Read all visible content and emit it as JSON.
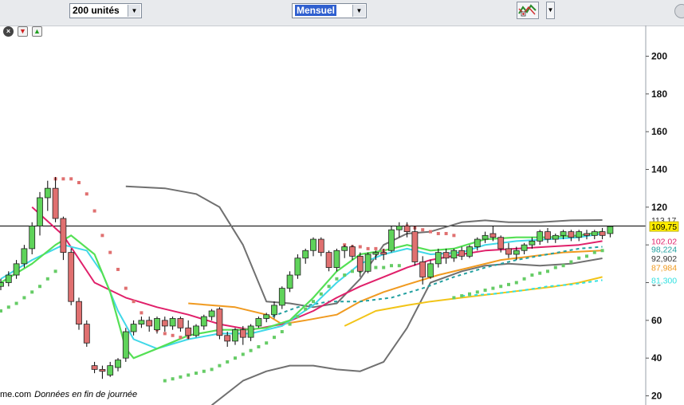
{
  "toolbar": {
    "period_select": "200 unités",
    "interval_select": "Mensuel"
  },
  "footer": {
    "source_fragment": "me.com",
    "note": "Données en fin de journée"
  },
  "colors": {
    "bull": "#5fd35a",
    "bear": "#e07070",
    "bollinger": "#707070",
    "ma_red": "#e0206a",
    "ma_green": "#55e055",
    "ma_cyan": "#40d8e8",
    "ma_orange": "#f09a20",
    "ma_yellow": "#f2c418",
    "dashed_teal": "#22a0a0",
    "dashed_cyan": "#30e0e0",
    "psar_bear": "#e07070",
    "psar_bull": "#66cc66"
  },
  "chart_data": {
    "type": "candlestick",
    "ylim": [
      15,
      220
    ],
    "yticks": [
      20,
      40,
      60,
      80,
      100,
      120,
      140,
      160,
      180,
      200
    ],
    "reference_line": 110,
    "price_labels": [
      {
        "text": "113,17",
        "value": 113.17,
        "bg": "#ffffff",
        "color": "#333333"
      },
      {
        "text": "109,75",
        "value": 109.75,
        "bg": "#ffee00",
        "color": "#000000"
      },
      {
        "text": "102,02",
        "value": 102.02,
        "bg": "#ffffff",
        "color": "#e0206a"
      },
      {
        "text": "98,224",
        "value": 97.8,
        "bg": "#ffffff",
        "color": "#22a0a0"
      },
      {
        "text": "92,902",
        "value": 92.902,
        "bg": "#ffffff",
        "color": "#333333"
      },
      {
        "text": "87,984",
        "value": 87.984,
        "bg": "#ffffff",
        "color": "#f09a20"
      },
      {
        "text": "81,300",
        "value": 81.3,
        "bg": "#ffffff",
        "color": "#30e0e0"
      }
    ],
    "candles": [
      [
        78,
        82,
        76,
        80
      ],
      [
        80,
        86,
        78,
        84
      ],
      [
        84,
        92,
        82,
        90
      ],
      [
        90,
        100,
        88,
        98
      ],
      [
        98,
        112,
        95,
        110
      ],
      [
        110,
        128,
        105,
        125
      ],
      [
        125,
        134,
        118,
        130
      ],
      [
        130,
        136,
        112,
        114
      ],
      [
        114,
        115,
        92,
        96
      ],
      [
        96,
        98,
        68,
        70
      ],
      [
        70,
        72,
        55,
        58
      ],
      [
        58,
        60,
        46,
        48
      ],
      [
        36,
        38,
        32,
        34
      ],
      [
        34,
        36,
        29,
        33
      ],
      [
        31,
        38,
        30,
        36
      ],
      [
        35,
        40,
        33,
        39
      ],
      [
        40,
        56,
        38,
        54
      ],
      [
        54,
        60,
        52,
        58
      ],
      [
        58,
        62,
        56,
        60
      ],
      [
        60,
        62,
        54,
        57
      ],
      [
        55,
        62,
        53,
        61
      ],
      [
        60,
        62,
        54,
        57
      ],
      [
        57,
        62,
        55,
        61
      ],
      [
        61,
        62,
        54,
        56
      ],
      [
        56,
        60,
        50,
        52
      ],
      [
        52,
        58,
        51,
        57
      ],
      [
        57,
        63,
        55,
        62
      ],
      [
        62,
        66,
        60,
        65
      ],
      [
        66,
        67,
        50,
        52
      ],
      [
        52,
        54,
        46,
        49
      ],
      [
        49,
        56,
        47,
        55
      ],
      [
        55,
        57,
        47,
        51
      ],
      [
        51,
        58,
        49,
        57
      ],
      [
        57,
        62,
        56,
        61
      ],
      [
        61,
        64,
        59,
        63
      ],
      [
        63,
        70,
        61,
        68
      ],
      [
        68,
        78,
        66,
        77
      ],
      [
        77,
        86,
        75,
        84
      ],
      [
        84,
        95,
        82,
        93
      ],
      [
        93,
        98,
        90,
        97
      ],
      [
        97,
        104,
        94,
        103
      ],
      [
        103,
        104,
        94,
        96
      ],
      [
        96,
        97,
        86,
        88
      ],
      [
        88,
        98,
        86,
        97
      ],
      [
        97,
        100,
        93,
        99
      ],
      [
        99,
        100,
        92,
        94
      ],
      [
        94,
        96,
        83,
        86
      ],
      [
        86,
        96,
        85,
        95
      ],
      [
        95,
        97,
        92,
        96
      ],
      [
        96,
        98,
        92,
        95
      ],
      [
        97,
        110,
        96,
        108
      ],
      [
        108,
        112,
        104,
        110
      ],
      [
        110,
        112,
        104,
        107
      ],
      [
        107,
        110,
        89,
        91
      ],
      [
        91,
        94,
        79,
        83
      ],
      [
        83,
        92,
        82,
        90
      ],
      [
        90,
        98,
        88,
        96
      ],
      [
        96,
        98,
        90,
        93
      ],
      [
        93,
        98,
        91,
        97
      ],
      [
        97,
        99,
        92,
        94
      ],
      [
        94,
        100,
        93,
        99
      ],
      [
        99,
        104,
        97,
        103
      ],
      [
        103,
        107,
        101,
        105
      ],
      [
        106,
        110,
        102,
        104
      ],
      [
        104,
        105,
        96,
        98
      ],
      [
        98,
        101,
        93,
        95
      ],
      [
        95,
        99,
        92,
        97
      ],
      [
        97,
        101,
        95,
        100
      ],
      [
        100,
        104,
        98,
        102
      ],
      [
        102,
        108,
        100,
        107
      ],
      [
        107,
        109,
        101,
        103
      ],
      [
        103,
        106,
        101,
        105
      ],
      [
        105,
        108,
        103,
        107
      ],
      [
        107,
        108,
        102,
        104
      ],
      [
        104,
        108,
        102,
        107
      ],
      [
        106,
        108,
        103,
        105
      ],
      [
        105,
        108,
        103,
        107
      ],
      [
        107,
        109,
        103,
        105
      ],
      [
        106,
        110,
        104,
        109.75
      ]
    ],
    "bollinger_upper": [
      [
        16,
        131
      ],
      [
        21,
        130
      ],
      [
        25,
        127
      ],
      [
        28,
        120
      ],
      [
        31,
        100
      ],
      [
        34,
        70
      ],
      [
        37,
        69
      ],
      [
        40,
        67
      ],
      [
        43,
        69
      ],
      [
        46,
        82
      ],
      [
        49,
        100
      ],
      [
        52,
        106
      ],
      [
        55,
        107
      ],
      [
        59,
        112
      ],
      [
        62,
        113
      ],
      [
        65,
        112
      ],
      [
        69,
        112
      ],
      [
        73,
        113
      ],
      [
        77,
        113.17
      ]
    ],
    "bollinger_lower": [
      [
        27,
        15
      ],
      [
        31,
        28
      ],
      [
        34,
        33
      ],
      [
        37,
        36
      ],
      [
        40,
        36
      ],
      [
        43,
        34
      ],
      [
        46,
        33
      ],
      [
        49,
        38
      ],
      [
        52,
        56
      ],
      [
        55,
        80
      ],
      [
        59,
        86
      ],
      [
        62,
        89
      ],
      [
        65,
        90
      ],
      [
        69,
        89
      ],
      [
        73,
        90
      ],
      [
        77,
        92.902
      ]
    ],
    "ma_red": [
      [
        4,
        120
      ],
      [
        8,
        105
      ],
      [
        12,
        80
      ],
      [
        16,
        72
      ],
      [
        20,
        67
      ],
      [
        24,
        63
      ],
      [
        28,
        58
      ],
      [
        32,
        55
      ],
      [
        36,
        58
      ],
      [
        40,
        65
      ],
      [
        43,
        72
      ],
      [
        46,
        78
      ],
      [
        49,
        83
      ],
      [
        52,
        88
      ],
      [
        55,
        92
      ],
      [
        59,
        95
      ],
      [
        62,
        97
      ],
      [
        66,
        98
      ],
      [
        70,
        99
      ],
      [
        74,
        100
      ],
      [
        77,
        102
      ]
    ],
    "ma_green": [
      [
        0,
        80
      ],
      [
        4,
        90
      ],
      [
        7,
        100
      ],
      [
        9,
        105
      ],
      [
        12,
        95
      ],
      [
        14,
        75
      ],
      [
        16,
        45
      ],
      [
        17,
        40
      ],
      [
        20,
        45
      ],
      [
        24,
        52
      ],
      [
        28,
        55
      ],
      [
        31,
        55
      ],
      [
        34,
        56
      ],
      [
        37,
        60
      ],
      [
        40,
        72
      ],
      [
        43,
        86
      ],
      [
        46,
        95
      ],
      [
        49,
        97
      ],
      [
        52,
        100
      ],
      [
        55,
        97
      ],
      [
        58,
        98
      ],
      [
        62,
        103
      ],
      [
        66,
        104
      ],
      [
        70,
        104
      ],
      [
        74,
        105
      ],
      [
        77,
        107
      ]
    ],
    "ma_cyan": [
      [
        0,
        82
      ],
      [
        4,
        92
      ],
      [
        8,
        100
      ],
      [
        11,
        97
      ],
      [
        13,
        85
      ],
      [
        15,
        65
      ],
      [
        17,
        50
      ],
      [
        20,
        45
      ],
      [
        24,
        50
      ],
      [
        28,
        53
      ],
      [
        32,
        53
      ],
      [
        36,
        57
      ],
      [
        40,
        68
      ],
      [
        43,
        80
      ],
      [
        46,
        90
      ],
      [
        49,
        95
      ],
      [
        52,
        98
      ],
      [
        55,
        95
      ],
      [
        59,
        96
      ],
      [
        62,
        100
      ],
      [
        66,
        102
      ],
      [
        70,
        103
      ],
      [
        74,
        104
      ],
      [
        77,
        106
      ]
    ],
    "ma_orange": [
      [
        24,
        69
      ],
      [
        30,
        67
      ],
      [
        34,
        63
      ],
      [
        36,
        58
      ],
      [
        39,
        60
      ],
      [
        43,
        63
      ],
      [
        46,
        70
      ],
      [
        49,
        75
      ],
      [
        52,
        79
      ],
      [
        56,
        84
      ],
      [
        60,
        88
      ],
      [
        64,
        92
      ],
      [
        68,
        94
      ],
      [
        72,
        96
      ],
      [
        77,
        97
      ]
    ],
    "ma_yellow": [
      [
        44,
        57
      ],
      [
        48,
        65
      ],
      [
        52,
        68
      ],
      [
        55,
        70
      ],
      [
        59,
        72
      ],
      [
        63,
        74
      ],
      [
        67,
        76
      ],
      [
        71,
        78
      ],
      [
        74,
        80
      ],
      [
        77,
        83
      ]
    ],
    "dashed_teal": [
      [
        34,
        61
      ],
      [
        38,
        67
      ],
      [
        42,
        70
      ],
      [
        46,
        70
      ],
      [
        50,
        72
      ],
      [
        54,
        77
      ],
      [
        58,
        83
      ],
      [
        62,
        88
      ],
      [
        66,
        92
      ],
      [
        70,
        95
      ],
      [
        74,
        98
      ],
      [
        77,
        99
      ]
    ],
    "dashed_cyan": [
      [
        59,
        73
      ],
      [
        63,
        74
      ],
      [
        67,
        76
      ],
      [
        70,
        78
      ],
      [
        73,
        79
      ],
      [
        77,
        81.3
      ]
    ],
    "psar_bear_points": [
      [
        7,
        135
      ],
      [
        8,
        135
      ],
      [
        9,
        135
      ],
      [
        10,
        133
      ],
      [
        11,
        127
      ],
      [
        12,
        118
      ],
      [
        13,
        105
      ],
      [
        14,
        96
      ],
      [
        15,
        87
      ],
      [
        16,
        77
      ],
      [
        17,
        70
      ],
      [
        18,
        64
      ],
      [
        19,
        58
      ],
      [
        20,
        55
      ],
      [
        21,
        53
      ],
      [
        22,
        52
      ],
      [
        23,
        51
      ],
      [
        24,
        51
      ],
      [
        44,
        100
      ],
      [
        45,
        99
      ],
      [
        46,
        99
      ],
      [
        47,
        98
      ],
      [
        48,
        98
      ],
      [
        49,
        97
      ],
      [
        52,
        110
      ],
      [
        53,
        109
      ],
      [
        54,
        108
      ],
      [
        55,
        107
      ],
      [
        56,
        106
      ],
      [
        57,
        106
      ],
      [
        58,
        105
      ]
    ],
    "psar_bull_points": [
      [
        0,
        65
      ],
      [
        1,
        67
      ],
      [
        2,
        69
      ],
      [
        3,
        72
      ],
      [
        4,
        75
      ],
      [
        5,
        78
      ],
      [
        6,
        82
      ],
      [
        7,
        86
      ],
      [
        21,
        28
      ],
      [
        22,
        29
      ],
      [
        23,
        30
      ],
      [
        24,
        31
      ],
      [
        25,
        32
      ],
      [
        26,
        33
      ],
      [
        27,
        34
      ],
      [
        28,
        36
      ],
      [
        29,
        38
      ],
      [
        30,
        40
      ],
      [
        31,
        42
      ],
      [
        32,
        44
      ],
      [
        33,
        46
      ],
      [
        34,
        48
      ],
      [
        35,
        51
      ],
      [
        36,
        54
      ],
      [
        37,
        58
      ],
      [
        38,
        62
      ],
      [
        39,
        66
      ],
      [
        40,
        70
      ],
      [
        41,
        74
      ],
      [
        42,
        78
      ],
      [
        43,
        82
      ],
      [
        44,
        84
      ],
      [
        45,
        86
      ],
      [
        46,
        86
      ],
      [
        47,
        87
      ],
      [
        48,
        88
      ],
      [
        49,
        88
      ],
      [
        50,
        89
      ],
      [
        51,
        89
      ],
      [
        58,
        72
      ],
      [
        59,
        73
      ],
      [
        60,
        74
      ],
      [
        61,
        75
      ],
      [
        62,
        76
      ],
      [
        63,
        77
      ],
      [
        64,
        78
      ],
      [
        65,
        79
      ],
      [
        66,
        80
      ],
      [
        67,
        82
      ],
      [
        68,
        84
      ],
      [
        69,
        85
      ],
      [
        70,
        86
      ],
      [
        71,
        88
      ],
      [
        72,
        89
      ],
      [
        73,
        91
      ],
      [
        74,
        93
      ],
      [
        75,
        94
      ],
      [
        76,
        96
      ],
      [
        77,
        97
      ]
    ]
  }
}
